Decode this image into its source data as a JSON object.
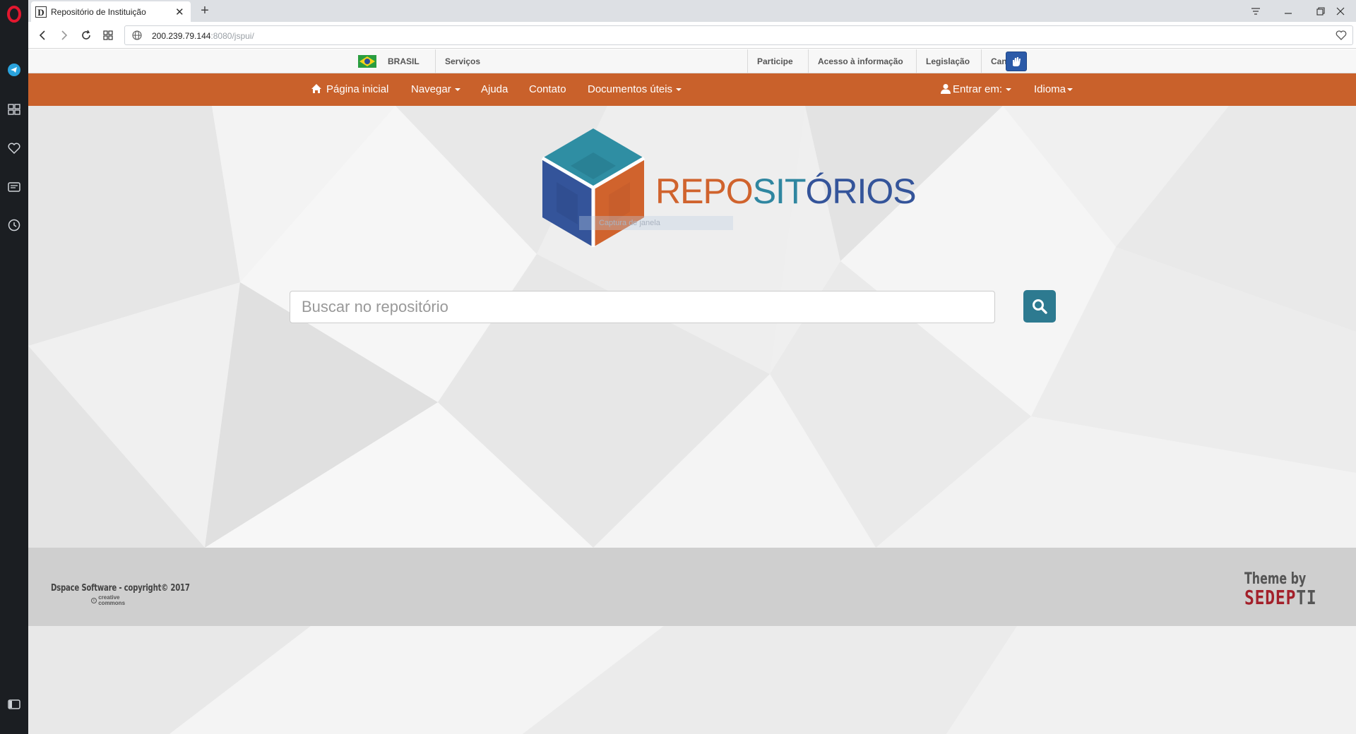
{
  "browser": {
    "tab": {
      "title": "Repositório de Instituição",
      "favicon": "D"
    },
    "url": {
      "host": "200.239.79.144",
      "rest": ":8080/jspui/"
    }
  },
  "govbar": {
    "country": "BRASIL",
    "services": "Serviços",
    "links": [
      "Participe",
      "Acesso à informação",
      "Legislação",
      "Canais"
    ]
  },
  "nav": {
    "home": "Página inicial",
    "browse": "Navegar",
    "help": "Ajuda",
    "contact": "Contato",
    "docs": "Documentos úteis",
    "login": "Entrar em:",
    "language": "Idioma"
  },
  "logo": {
    "part1": "REPO",
    "part2": "SIT",
    "part3": "Ó",
    "part4": "RIOS",
    "ghost_tooltip": "Captura de janela"
  },
  "search": {
    "placeholder": "Buscar no repositório"
  },
  "footer": {
    "copyright": "Dspace Software - copyright© 2017",
    "cc": [
      "creative",
      "commons"
    ],
    "theme_by": "Theme by",
    "brand_a": "SEDEP",
    "brand_b": "TI"
  },
  "colors": {
    "nav_orange": "#c9612b",
    "logo_orange": "#d0632d",
    "logo_teal": "#2f86a0",
    "logo_blue": "#34549a",
    "search_button": "#2d7a90",
    "sedep_red": "#a3202a"
  }
}
